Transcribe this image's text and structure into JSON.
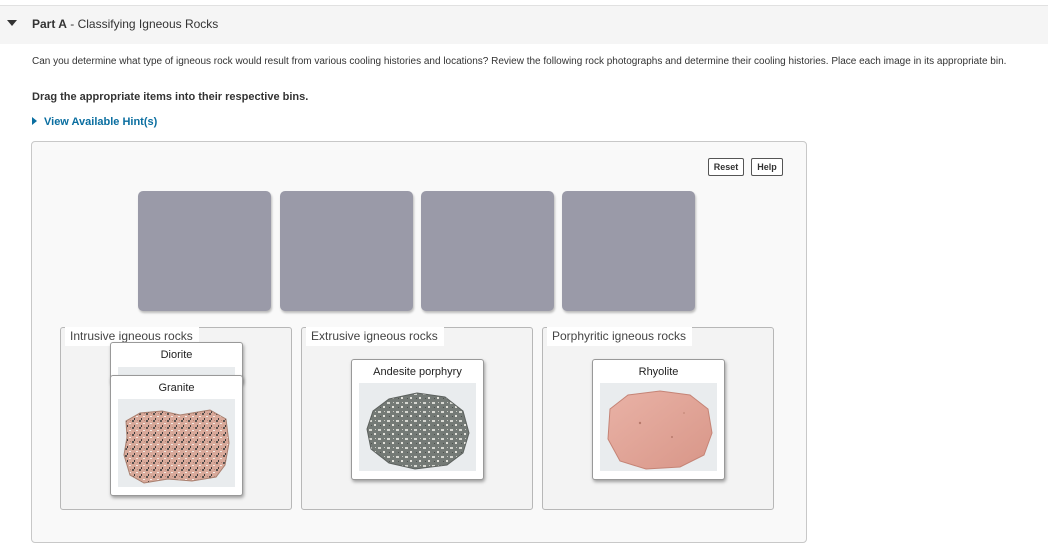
{
  "part": {
    "label": "Part A",
    "separator": " - ",
    "title": "Classifying Igneous Rocks"
  },
  "intro_text": "Can you determine what type of igneous rock would result from various cooling histories and locations? Review the following rock photographs and determine their cooling histories. Place each image in its appropriate bin.",
  "instruction": "Drag the appropriate items into their respective bins.",
  "hint_link": "View Available Hint(s)",
  "toolbar": {
    "reset_label": "Reset",
    "help_label": "Help"
  },
  "bins": [
    {
      "label": "Intrusive igneous rocks",
      "cards": [
        "Diorite",
        "Granite"
      ]
    },
    {
      "label": "Extrusive igneous rocks",
      "cards": [
        "Andesite porphyry"
      ]
    },
    {
      "label": "Porphyritic igneous rocks",
      "cards": [
        "Rhyolite"
      ]
    }
  ],
  "colors": {
    "link": "#0a6ea0",
    "empty_slot": "#9a9aa8"
  }
}
